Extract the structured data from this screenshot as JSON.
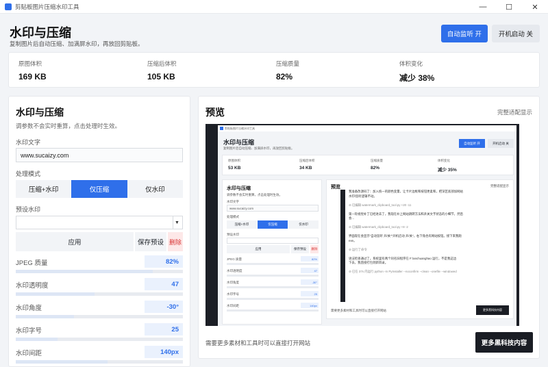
{
  "window": {
    "title": "剪贴板图片压缩水印工具",
    "minimize": "—",
    "maximize": "☐",
    "close": "✕"
  },
  "header": {
    "title": "水印与压缩",
    "subtitle": "复制图片后自动压缩、加满屏水印，再放回剪贴板。",
    "auto_listen_button": "自动监听 开",
    "startup_button": "开机启动 关"
  },
  "stats": [
    {
      "label": "原图体积",
      "value": "169 KB"
    },
    {
      "label": "压缩后体积",
      "value": "105 KB"
    },
    {
      "label": "压缩质量",
      "value": "82%"
    },
    {
      "label": "体积变化",
      "value": "减少 38%"
    }
  ],
  "settings": {
    "title": "水印与压缩",
    "subtitle": "调参数不会实时重算，点击处理时生效。",
    "watermark_text_label": "水印文字",
    "watermark_text_value": "www.sucaizy.com",
    "mode_label": "处理模式",
    "modes": [
      "压缩+水印",
      "仅压缩",
      "仅水印"
    ],
    "active_mode": "仅压缩",
    "preset_label": "预设水印",
    "preset_value": "",
    "apply_button": "应用",
    "save_preset_button": "保存预设",
    "delete_button": "删除",
    "params": [
      {
        "label": "JPEG 质量",
        "value": "82%",
        "level": 0.82
      },
      {
        "label": "水印透明度",
        "value": "47",
        "level": 0.47
      },
      {
        "label": "水印角度",
        "value": "-30°",
        "level": 0.35
      },
      {
        "label": "水印字号",
        "value": "25",
        "level": 0.25
      },
      {
        "label": "水印间距",
        "value": "140px",
        "level": 0.55
      }
    ]
  },
  "preview": {
    "title": "预览",
    "fit_link": "完整适配显示",
    "footer_text": "需要更多素材和工具时可以直接打开网站",
    "more_button": "更多黑科技内容"
  },
  "mini": {
    "title_bar": "剪贴板图片压缩水印工具",
    "title": "水印与压缩",
    "subtitle": "复制图片后自动压缩、加满屏水印，再放回剪贴板。",
    "btn1": "自动监听 开",
    "btn2": "开机启动 关",
    "stats": [
      {
        "label": "原图体积",
        "value": "53 KB"
      },
      {
        "label": "压缩后体积",
        "value": "34 KB"
      },
      {
        "label": "压缩质量",
        "value": "82%"
      },
      {
        "label": "体积变化",
        "value": "减少 35%"
      }
    ],
    "left_title": "水印与压缩",
    "left_sub": "调参数不会实时重算，点击处理时生效。",
    "wm_label": "水印文字",
    "wm_value": "www.sucaizy.com",
    "mode_label": "处理模式",
    "modes": [
      "压缩+水印",
      "仅压缩",
      "仅水印"
    ],
    "preset_label": "预设水印",
    "apply": "应用",
    "save": "保存预设",
    "del": "删除",
    "params": [
      {
        "label": "JPEG 质量",
        "value": "82%"
      },
      {
        "label": "水印透明度",
        "value": "47"
      },
      {
        "label": "水印角度",
        "value": "-30°"
      },
      {
        "label": "水印字号",
        "value": "25"
      },
      {
        "label": "水印间距",
        "value": "140px"
      }
    ],
    "right_title": "预览",
    "right_link": "完整适配显示",
    "text_lines": [
      "我准备改源码了：加入统一的颜色变量，让卡片边框和按钮更柔和，把深区底部加网站",
      "水印/监听逻辑不动。",
      "",
      "⊘ 已编辑 watermark_clipboard_tool.py +20 -11",
      "",
      "第一轮视觉补丁已经进去了，我现在补上网站跳转方法和开关文字状态的小细节，然后",
      "会...",
      "",
      "⊘ 已编辑 watermark_clipboard_tool.py +8 -2",
      "",
      "界面现在会显示\"自动监听 开/关\"\"开机启动 开/关\"，右下角也有网站按钮。接下来我跑",
      "exe。",
      "",
      "⊘ 运行了命令",
      "",
      "语法检查通过了。系统里有两个同名旧程序在 F:\\anchuanghao 运行，不是我这边",
      "下去，我直接打包到新目录。",
      "",
      "⊘ 已在 37s 内运行 python -m PyInstaller --noconfirm --clean --onefile --windowed"
    ],
    "footer": "需要更多素材和工具时可以直接打开网站",
    "dark_btn": "更多黑科技内容"
  }
}
